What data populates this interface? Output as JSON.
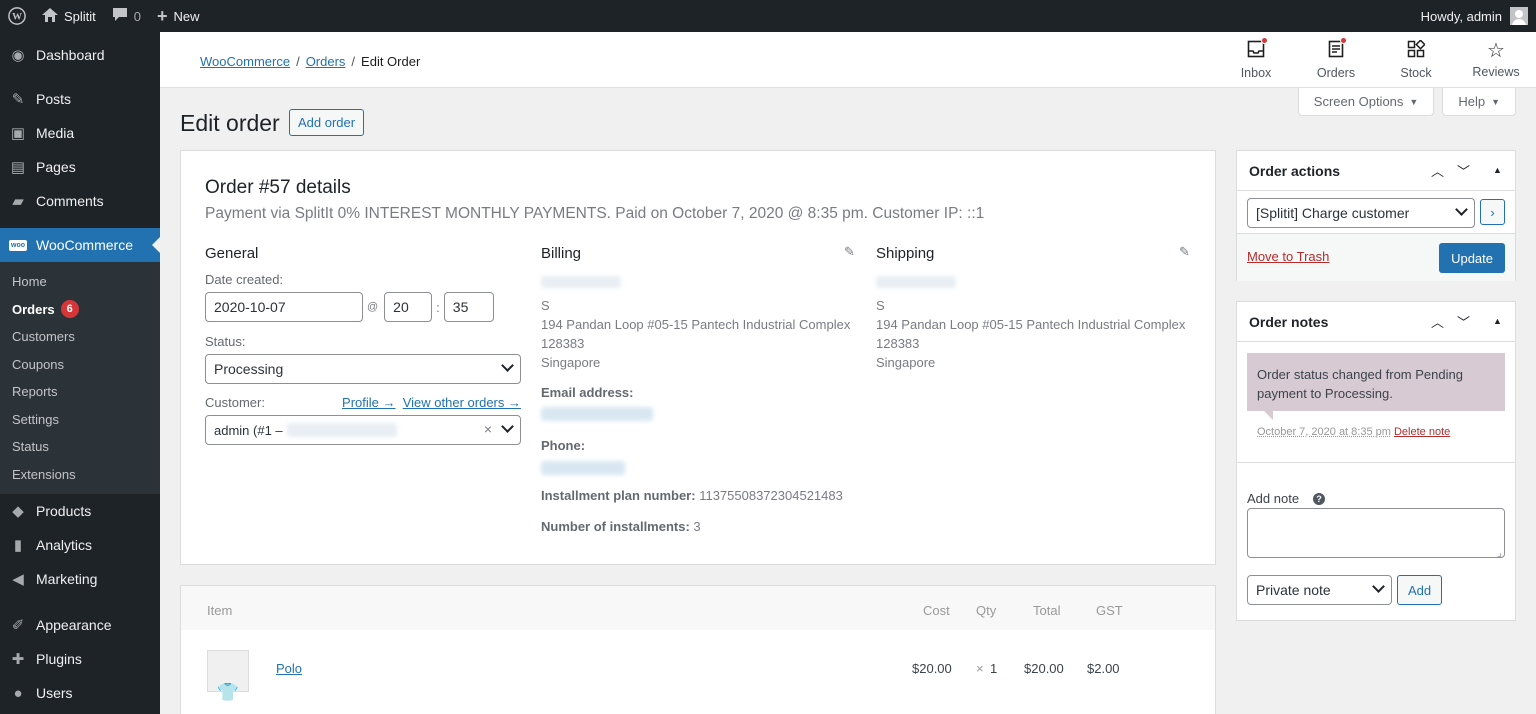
{
  "adminbar": {
    "site_name": "Splitit",
    "comments_count": "0",
    "new_label": "New",
    "howdy": "Howdy, admin"
  },
  "sidebar": {
    "items": [
      {
        "label": "Dashboard",
        "icon": "dashboard-icon"
      },
      {
        "label": "Posts",
        "icon": "pin-icon"
      },
      {
        "label": "Media",
        "icon": "media-icon"
      },
      {
        "label": "Pages",
        "icon": "page-icon"
      },
      {
        "label": "Comments",
        "icon": "comment-icon"
      },
      {
        "label": "WooCommerce",
        "icon": "woo-icon"
      }
    ],
    "submenu": [
      {
        "label": "Home"
      },
      {
        "label": "Orders",
        "badge": "6"
      },
      {
        "label": "Customers"
      },
      {
        "label": "Coupons"
      },
      {
        "label": "Reports"
      },
      {
        "label": "Settings"
      },
      {
        "label": "Status"
      },
      {
        "label": "Extensions"
      }
    ],
    "items_after": [
      {
        "label": "Products",
        "icon": "box-icon"
      },
      {
        "label": "Analytics",
        "icon": "bar-chart-icon"
      },
      {
        "label": "Marketing",
        "icon": "megaphone-icon"
      },
      {
        "label": "Appearance",
        "icon": "brush-icon"
      },
      {
        "label": "Plugins",
        "icon": "plug-icon"
      },
      {
        "label": "Users",
        "icon": "user-icon"
      }
    ]
  },
  "header": {
    "breadcrumb": [
      "WooCommerce",
      "Orders",
      "Edit Order"
    ],
    "actions": [
      {
        "label": "Inbox",
        "icon": "inbox-icon"
      },
      {
        "label": "Orders",
        "icon": "orders-icon"
      },
      {
        "label": "Stock",
        "icon": "stock-icon"
      },
      {
        "label": "Reviews",
        "icon": "star-icon"
      }
    ]
  },
  "screen_tabs": {
    "screen_options": "Screen Options",
    "help": "Help"
  },
  "page": {
    "title": "Edit order",
    "add_order": "Add order"
  },
  "order": {
    "heading": "Order #57 details",
    "subtitle": "Payment via SplitIt 0% INTEREST MONTHLY PAYMENTS. Paid on October 7, 2020 @ 8:35 pm. Customer IP: ::1",
    "general": {
      "title": "General",
      "date_label": "Date created:",
      "date": "2020-10-07",
      "at": "@",
      "hour": "20",
      "colon": ":",
      "minute": "35",
      "status_label": "Status:",
      "status": "Processing",
      "customer_label": "Customer:",
      "profile_link": "Profile →",
      "other_orders_link": "View other orders →",
      "customer_value": "admin (#1 –",
      "clear": "×"
    },
    "billing": {
      "title": "Billing",
      "initial": "S",
      "address1": "194 Pandan Loop #05-15 Pantech Industrial Complex",
      "postcode": "128383",
      "country": "Singapore",
      "email_label": "Email address:",
      "phone_label": "Phone:",
      "plan_label": "Installment plan number:",
      "plan_value": "11375508372304521483",
      "num_label": "Number of installments:",
      "num_value": "3"
    },
    "shipping": {
      "title": "Shipping",
      "initial": "S",
      "address1": "194 Pandan Loop #05-15 Pantech Industrial Complex",
      "postcode": "128383",
      "country": "Singapore"
    }
  },
  "items": {
    "headers": {
      "item": "Item",
      "cost": "Cost",
      "qty": "Qty",
      "total": "Total",
      "gst": "GST"
    },
    "rows": [
      {
        "name": "Polo",
        "cost": "$20.00",
        "qty_x": "×",
        "qty": "1",
        "total": "$20.00",
        "gst": "$2.00"
      }
    ]
  },
  "order_actions": {
    "title": "Order actions",
    "selected": "[Splitit] Charge customer",
    "move_trash": "Move to Trash",
    "update": "Update"
  },
  "order_notes": {
    "title": "Order notes",
    "note_text": "Order status changed from Pending payment to Processing.",
    "note_date": "October 7, 2020 at 8:35 pm",
    "delete": "Delete note",
    "add_note_label": "Add note",
    "help": "?",
    "note_type": "Private note",
    "add": "Add"
  },
  "colors": {
    "accent": "#2271b1",
    "admin_bar": "#1d2327",
    "badge": "#d63638",
    "note_bg": "#d7cad2"
  }
}
